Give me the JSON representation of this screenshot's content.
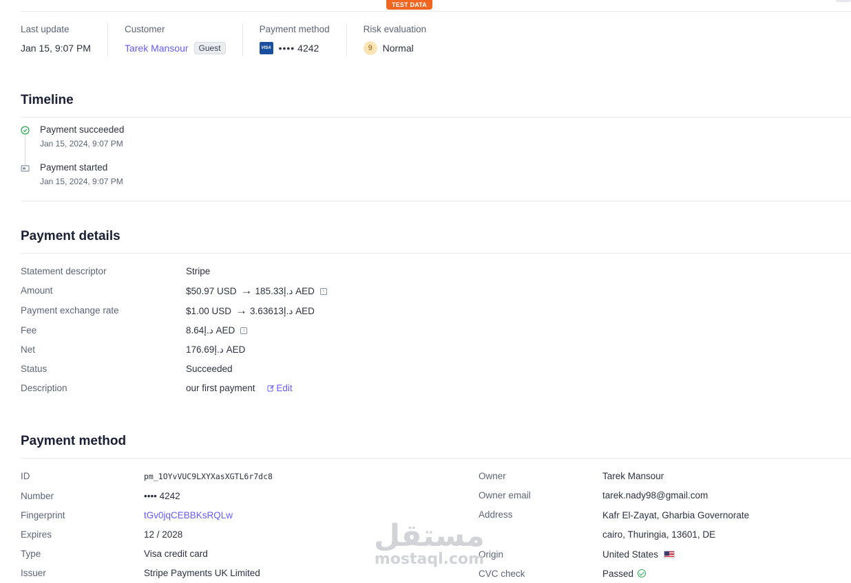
{
  "top": {
    "test_badge": "TEST DATA"
  },
  "summary": {
    "last_update": {
      "label": "Last update",
      "value": "Jan 15, 9:07 PM"
    },
    "customer": {
      "label": "Customer",
      "name": "Tarek Mansour",
      "badge": "Guest"
    },
    "payment_method": {
      "label": "Payment method",
      "brand": "VISA",
      "dots": "••••",
      "last4": "4242"
    },
    "risk": {
      "label": "Risk evaluation",
      "score": "9",
      "level": "Normal"
    }
  },
  "timeline": {
    "title": "Timeline",
    "events": [
      {
        "title": "Payment succeeded",
        "time": "Jan 15, 2024, 9:07 PM",
        "icon": "check-circle-icon"
      },
      {
        "title": "Payment started",
        "time": "Jan 15, 2024, 9:07 PM",
        "icon": "card-icon"
      }
    ]
  },
  "payment_details": {
    "title": "Payment details",
    "rows": {
      "statement_descriptor": {
        "label": "Statement descriptor",
        "value": "Stripe"
      },
      "amount": {
        "label": "Amount",
        "from": "$50.97 USD",
        "to": "185.33د.إ AED"
      },
      "exchange_rate": {
        "label": "Payment exchange rate",
        "from": "$1.00 USD",
        "to": "3.63613د.إ AED"
      },
      "fee": {
        "label": "Fee",
        "value": "8.64د.إ AED"
      },
      "net": {
        "label": "Net",
        "value": "176.69د.إ AED"
      },
      "status": {
        "label": "Status",
        "value": "Succeeded"
      },
      "description": {
        "label": "Description",
        "value": "our first payment",
        "edit": "Edit"
      }
    }
  },
  "payment_method": {
    "title": "Payment method",
    "left": {
      "id": {
        "label": "ID",
        "value": "pm_1OYvVUC9LXYXasXGTL6r7dc8"
      },
      "number": {
        "label": "Number",
        "value": "•••• 4242"
      },
      "fingerprint": {
        "label": "Fingerprint",
        "value": "tGv0jqCEBBKsRQLw"
      },
      "expires": {
        "label": "Expires",
        "value": "12 / 2028"
      },
      "type": {
        "label": "Type",
        "value": "Visa credit card"
      },
      "issuer": {
        "label": "Issuer",
        "value": "Stripe Payments UK Limited"
      }
    },
    "right": {
      "owner": {
        "label": "Owner",
        "value": "Tarek Mansour"
      },
      "owner_email": {
        "label": "Owner email",
        "value": "tarek.nady98@gmail.com"
      },
      "address": {
        "label": "Address",
        "line1": "Kafr El-Zayat, Gharbia Governorate",
        "line2": "cairo, Thuringia, 13601, DE"
      },
      "origin": {
        "label": "Origin",
        "value": "United States"
      },
      "cvc": {
        "label": "CVC check",
        "value": "Passed"
      }
    }
  },
  "watermark": {
    "arabic": "مستقل",
    "latin": "mostaql.com"
  },
  "colors": {
    "accent": "#635bff",
    "test_badge": "#f0651f",
    "success": "#2bab52"
  }
}
